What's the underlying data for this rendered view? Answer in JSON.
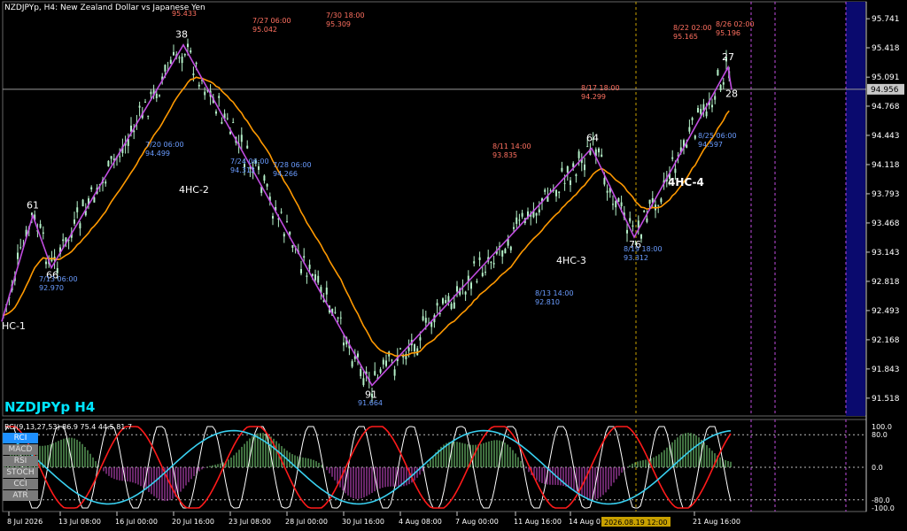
{
  "window": {
    "header": "NZDJPYp, H4:  New Zealand Dollar vs Japanese Yen",
    "symbol_label": "NZDJPYp H4"
  },
  "colors": {
    "zigzag": "#c04ce0",
    "ma": "#ff9900",
    "candle": "#b4f0c8",
    "rci_short": "#ffffff",
    "rci_mid": "#ff1a1a",
    "rci_long": "#39d0f0",
    "annotation_price": "#ff7060",
    "annotation_time": "#6a9cff",
    "current_price_bg": "#c8c8c8",
    "time_cursor_bg": "#c8a000",
    "right_panel": "#0a0a6e"
  },
  "price_axis": {
    "ylim": [
      91.32,
      95.93
    ],
    "ticks": [
      "95.741",
      "95.418",
      "95.091",
      "94.768",
      "94.443",
      "94.118",
      "93.793",
      "93.468",
      "93.143",
      "92.818",
      "92.493",
      "92.168",
      "91.843",
      "91.518"
    ],
    "current_price": "94.956"
  },
  "time_axis": {
    "ticks": [
      "8 Jul 2026",
      "13 Jul 08:00",
      "16 Jul 00:00",
      "20 Jul 16:00",
      "23 Jul 08:00",
      "28 Jul 00:00",
      "30 Jul 16:00",
      "4 Aug 08:00",
      "7 Aug 00:00",
      "11 Aug 16:00",
      "14 Aug 0",
      "21 Aug 16:00"
    ],
    "cursor_label": "2026.08.19 12:00"
  },
  "zigzag_points": [
    {
      "label": "HC-1",
      "price": 92.37
    },
    {
      "label": "61",
      "price": 93.55
    },
    {
      "label": "66",
      "price": 92.97
    },
    {
      "label": "38",
      "price": 95.45
    },
    {
      "label": "4HC-2",
      "price": 95.0
    },
    {
      "label": "91",
      "price": 91.66
    },
    {
      "label": "4HC-3",
      "price": 93.0
    },
    {
      "label": "64",
      "price": 94.3
    },
    {
      "label": "76",
      "price": 93.31
    },
    {
      "label": "4HC-4",
      "price": 94.0
    },
    {
      "label": "27",
      "price": 95.2
    },
    {
      "label": "28",
      "price": 94.95
    }
  ],
  "annotations": [
    {
      "price": "95.433",
      "time": ""
    },
    {
      "price": "95.042",
      "time": "7/27 06:00"
    },
    {
      "price": "95.309",
      "time": "7/30 18:00"
    },
    {
      "price": "95.165",
      "time": "8/22 02:00"
    },
    {
      "price": "95.196",
      "time": "8/26 02:00"
    },
    {
      "price": "94.299",
      "time": "8/17 18:00"
    },
    {
      "price": "93.835",
      "time": "8/11 14:00"
    },
    {
      "price": "94.499",
      "time": "7/20 06:00"
    },
    {
      "price": "94.313",
      "time": "7/24 06:00"
    },
    {
      "price": "94.266",
      "time": "7/28 06:00"
    },
    {
      "price": "92.970",
      "time": "7/13 06:00"
    },
    {
      "price": "91.664",
      "time": ""
    },
    {
      "price": "92.810",
      "time": "8/13 14:00"
    },
    {
      "price": "93.312",
      "time": "8/19 18:00"
    },
    {
      "price": "94.597",
      "time": "8/25 06:00"
    }
  ],
  "indicator": {
    "title": "RCI(9,13,27,53) 86.9 75.4 44.5 81.7",
    "tabs": [
      "RCI",
      "MACD",
      "RSI",
      "STOCH",
      "CCI",
      "ATR"
    ],
    "active_tab": "RCI",
    "levels": [
      "100.0",
      "80.0",
      "0.0",
      "-80.0",
      "-100.0"
    ]
  }
}
